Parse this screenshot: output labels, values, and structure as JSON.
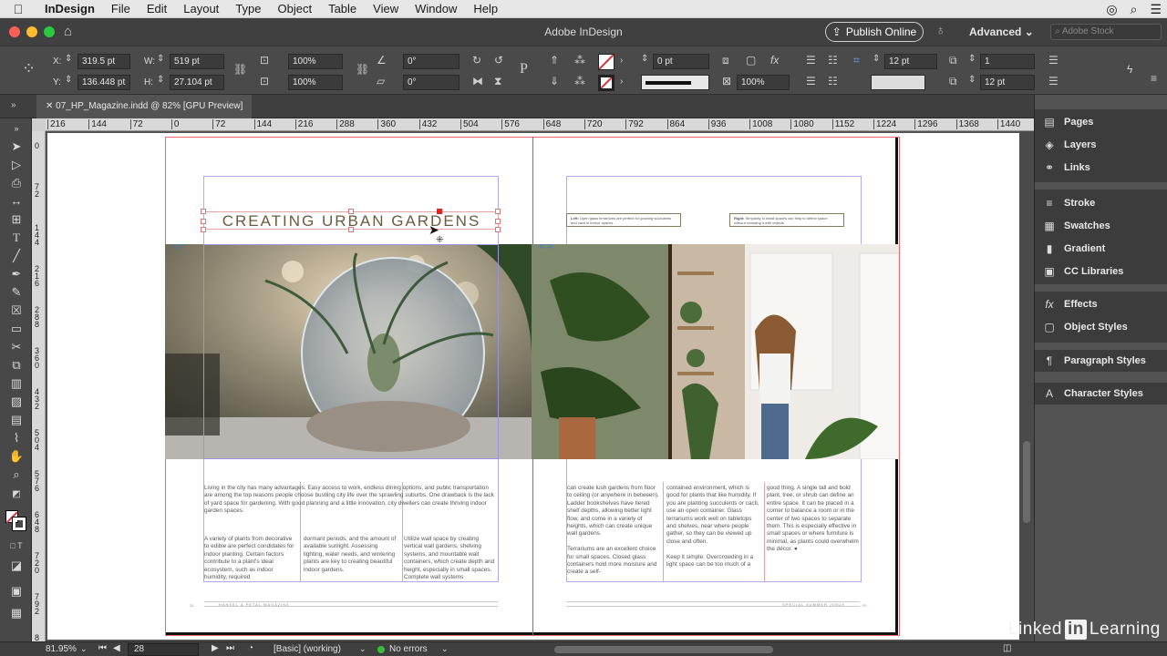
{
  "menubar": {
    "app_name": "InDesign",
    "items": [
      "File",
      "Edit",
      "Layout",
      "Type",
      "Object",
      "Table",
      "View",
      "Window",
      "Help"
    ]
  },
  "appbar": {
    "title": "Adobe InDesign",
    "publish_label": "Publish Online",
    "workspace_label": "Advanced",
    "stock_placeholder": "Adobe Stock"
  },
  "control": {
    "x_label": "X:",
    "x_value": "319.5 pt",
    "y_label": "Y:",
    "y_value": "136.448 pt",
    "w_label": "W:",
    "w_value": "519 pt",
    "h_label": "H:",
    "h_value": "27.104 pt",
    "scale_x": "100%",
    "scale_y": "100%",
    "rotate": "0°",
    "shear": "0°",
    "stroke_weight": "0 pt",
    "opacity": "100%",
    "gutter_1": "12 pt",
    "gutter_2": "12 pt",
    "columns": "1"
  },
  "doc_tab": {
    "label": "07_HP_Magazine.indd @ 82% [GPU Preview]"
  },
  "ruler": {
    "h_ticks": [
      "216",
      "144",
      "72",
      "0",
      "72",
      "144",
      "216",
      "288",
      "360",
      "432",
      "504",
      "576",
      "648",
      "720",
      "792",
      "864",
      "936",
      "1008",
      "1080",
      "1152",
      "1224",
      "1296",
      "1368",
      "1440"
    ],
    "v_ticks": [
      "0",
      "7 2",
      "1 4 4",
      "2 1 6",
      "2 8 8",
      "3 6 0",
      "4 3 2",
      "5 0 4",
      "5 7 6",
      "6 4 8",
      "7 2 0",
      "7 9 2",
      "8"
    ]
  },
  "document": {
    "headline": "CREATING URBAN GARDENS",
    "left_intro": "Living in the city has many advantages. Easy access to work, endless dining options, and public transportation are among the top reasons people choose bustling city life over the sprawling suburbs. One drawback is the lack of yard space for gardening. With good planning and a little innovation, city dwellers can create thriving indoor garden spaces.",
    "left_col1": "A variety of plants from decorative to edible are perfect condidates for indoor planting. Certain factors contribute to a plant's ideal ecosystem, such as indoor humidity, required",
    "left_col2": "dormant periods, and the amount of available sunlight. Assessing lighting, water needs, and wintering plants are key to creating beautiful indoor gardens.",
    "left_col3": "Utilize wall space by creating vertical wall gardens, shelving systems, and mountable wall containers, which create depth and height, especially in small spaces. Complete wall systems",
    "right_col1": "can create lush gardens from floor to ceiling (or anywhere in between). Ladder bookshelves have tiered shelf depths, allowing better light flow, and come in a variety of heights, which can create unique wall gardens.\n\nTerrariums are an excellent choice for small spaces. Closed glass containers hold more moisture and create a self-",
    "right_col2": "contained environment, which is good for plants that like humidity. If you are planting succulents or cacti, use an open container. Glass terrariums work well on tabletops and shelves, near where people gather, so they can be viewed up close and often.\n\nKeep it simple. Overcrowding in a light space can be too much of a",
    "right_col3": "good thing. A single tall and bold plant, tree, or shrub can define an entire space. It can be placed in a corner to balance a room or in the center of two spaces to separate them. This is especially effective in small spaces or where furniture is minimal, as plants could overwhelm the décor. ●",
    "caption_left_label": "Left:",
    "caption_left": "Open glass terrariums are perfect for growing succulents and cacti in indoor spaces.",
    "caption_right_label": "Right:",
    "caption_right": "Simplicity in small spaces can help to define space without crowding it with objects.",
    "folio_left_page": "28",
    "folio_left_text": "HANSEL & PETAL MAGAZINE",
    "folio_right_page": "29",
    "folio_right_text": "SPECIAL SUMMER ISSUE"
  },
  "panels": {
    "group1": [
      {
        "icon": "pages-icon",
        "glyph": "▤",
        "label": "Pages"
      },
      {
        "icon": "layers-icon",
        "glyph": "◈",
        "label": "Layers"
      },
      {
        "icon": "links-icon",
        "glyph": "⚭",
        "label": "Links"
      }
    ],
    "group2": [
      {
        "icon": "stroke-icon",
        "glyph": "≡",
        "label": "Stroke"
      },
      {
        "icon": "swatches-icon",
        "glyph": "▦",
        "label": "Swatches"
      },
      {
        "icon": "gradient-icon",
        "glyph": "▮",
        "label": "Gradient"
      },
      {
        "icon": "cc-libraries-icon",
        "glyph": "▣",
        "label": "CC Libraries"
      }
    ],
    "group3": [
      {
        "icon": "effects-icon",
        "glyph": "fx",
        "label": "Effects"
      },
      {
        "icon": "object-styles-icon",
        "glyph": "▢",
        "label": "Object Styles"
      }
    ],
    "group4": [
      {
        "icon": "paragraph-styles-icon",
        "glyph": "¶",
        "label": "Paragraph Styles"
      }
    ],
    "group5": [
      {
        "icon": "character-styles-icon",
        "glyph": "A",
        "label": "Character Styles"
      }
    ]
  },
  "status": {
    "zoom": "81.95%",
    "page": "28",
    "master": "[Basic] (working)",
    "preflight": "No errors"
  },
  "watermark": {
    "left": "Linked",
    "in": "in",
    "right": "Learning"
  },
  "colors": {
    "headline": "#6b5a3e",
    "accent_red": "#d33",
    "preflight_ok": "#3bbb3b"
  }
}
